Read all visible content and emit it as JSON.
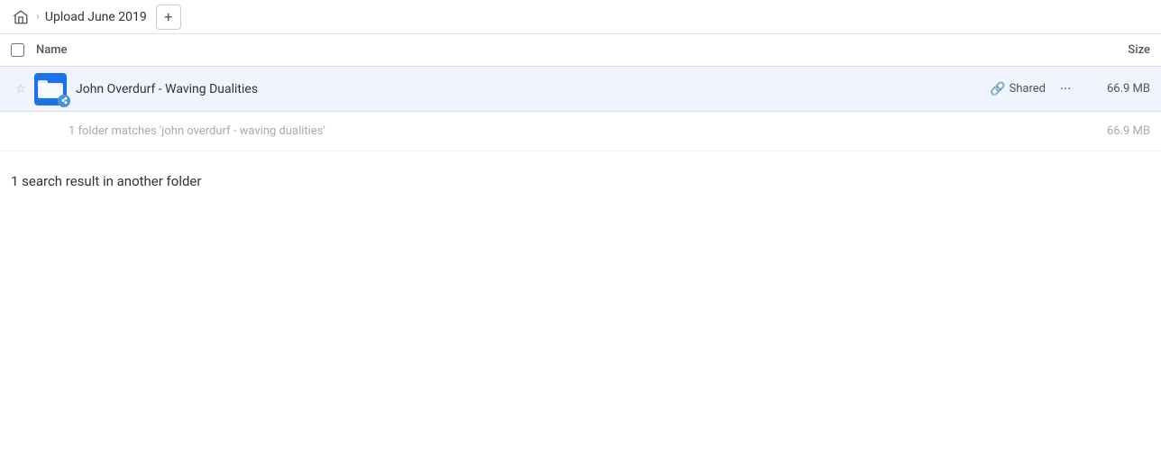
{
  "breadcrumb": {
    "home_label": "Home",
    "current_folder": "Upload June 2019",
    "add_button_label": "+"
  },
  "columns": {
    "name_label": "Name",
    "size_label": "Size"
  },
  "file_row": {
    "name": "John Overdurf - Waving Dualities",
    "shared_label": "Shared",
    "size": "66.9 MB",
    "more_icon": "···"
  },
  "search_info": {
    "text": "1 folder matches 'john overdurf - waving dualities'",
    "size": "66.9 MB"
  },
  "another_folder": {
    "label": "1 search result in another folder"
  }
}
